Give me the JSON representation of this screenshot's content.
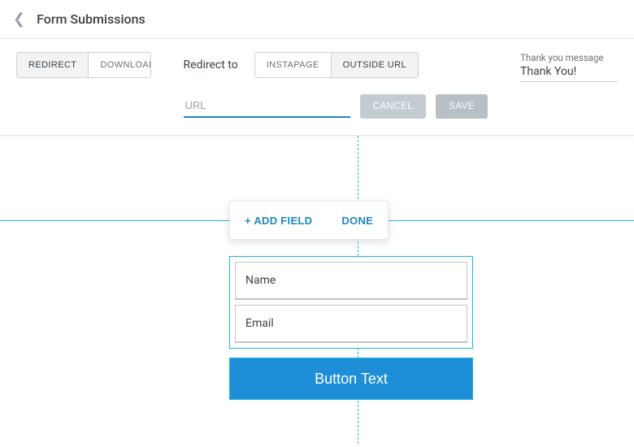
{
  "header": {
    "title": "Form Submissions"
  },
  "settings": {
    "mode_tabs": {
      "redirect": "REDIRECT",
      "download": "DOWNLOAD"
    },
    "redirect_label": "Redirect to",
    "target_tabs": {
      "instapage": "INSTAPAGE",
      "outside": "OUTSIDE URL"
    },
    "url_placeholder": "URL",
    "url_value": "",
    "cancel": "CANCEL",
    "save": "SAVE",
    "thank_label": "Thank you message",
    "thank_value": "Thank You!"
  },
  "popup": {
    "add_field": "+ ADD FIELD",
    "done": "DONE"
  },
  "form": {
    "fields": [
      {
        "label": "Name"
      },
      {
        "label": "Email"
      }
    ],
    "button": "Button Text"
  }
}
